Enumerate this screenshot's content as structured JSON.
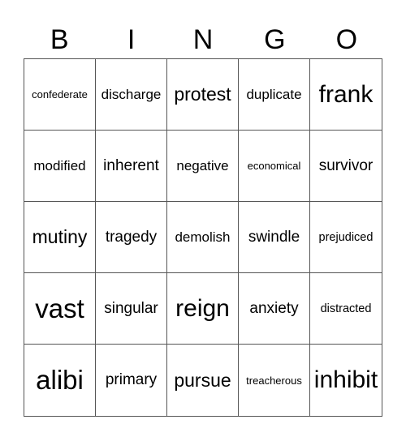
{
  "header": [
    "B",
    "I",
    "N",
    "G",
    "O"
  ],
  "cells": [
    {
      "word": "confederate",
      "size": "s13"
    },
    {
      "word": "discharge",
      "size": "s17"
    },
    {
      "word": "protest",
      "size": "s22"
    },
    {
      "word": "duplicate",
      "size": "s17"
    },
    {
      "word": "frank",
      "size": "s28"
    },
    {
      "word": "modified",
      "size": "s17"
    },
    {
      "word": "inherent",
      "size": "s19"
    },
    {
      "word": "negative",
      "size": "s17"
    },
    {
      "word": "economical",
      "size": "s13"
    },
    {
      "word": "survivor",
      "size": "s19"
    },
    {
      "word": "mutiny",
      "size": "s22"
    },
    {
      "word": "tragedy",
      "size": "s19"
    },
    {
      "word": "demolish",
      "size": "s17"
    },
    {
      "word": "swindle",
      "size": "s19"
    },
    {
      "word": "prejudiced",
      "size": "s14"
    },
    {
      "word": "vast",
      "size": "s32"
    },
    {
      "word": "singular",
      "size": "s19"
    },
    {
      "word": "reign",
      "size": "s28"
    },
    {
      "word": "anxiety",
      "size": "s19"
    },
    {
      "word": "distracted",
      "size": "s14"
    },
    {
      "word": "alibi",
      "size": "s32"
    },
    {
      "word": "primary",
      "size": "s19"
    },
    {
      "word": "pursue",
      "size": "s22"
    },
    {
      "word": "treacherous",
      "size": "s13"
    },
    {
      "word": "inhibit",
      "size": "s28"
    }
  ]
}
